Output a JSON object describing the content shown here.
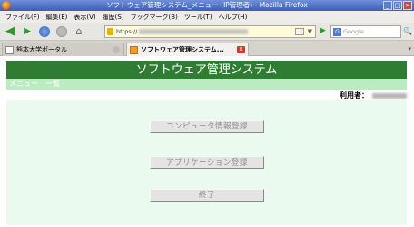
{
  "window": {
    "title": "ソフトウェア管理システム_メニュー (IP管理者) - Mozilla Firefox",
    "buttons": [
      "_",
      "□",
      "×"
    ]
  },
  "menubar": {
    "items": [
      "ファイル(F)",
      "編集(E)",
      "表示(V)",
      "履歴(S)",
      "ブックマーク(B)",
      "ツール(T)",
      "ヘルプ(H)"
    ]
  },
  "navbar": {
    "url_prefix": "https://",
    "search_placeholder": "Google"
  },
  "tabs": [
    {
      "label": "熊本大学ポータル"
    },
    {
      "label": "ソフトウェア管理システム..."
    }
  ],
  "page": {
    "header_title": "ソフトウェア管理システム",
    "subheader": "メニュー　一覧",
    "user_label": "利用者：",
    "buttons": {
      "computer_register": "コンピュータ情報登録",
      "application_register": "アプリケーション登録",
      "exit": "終了"
    }
  },
  "colors": {
    "header_bg": "#2e7d32",
    "subheader_bg": "#b9ecc1",
    "main_bg": "#eafaee"
  }
}
